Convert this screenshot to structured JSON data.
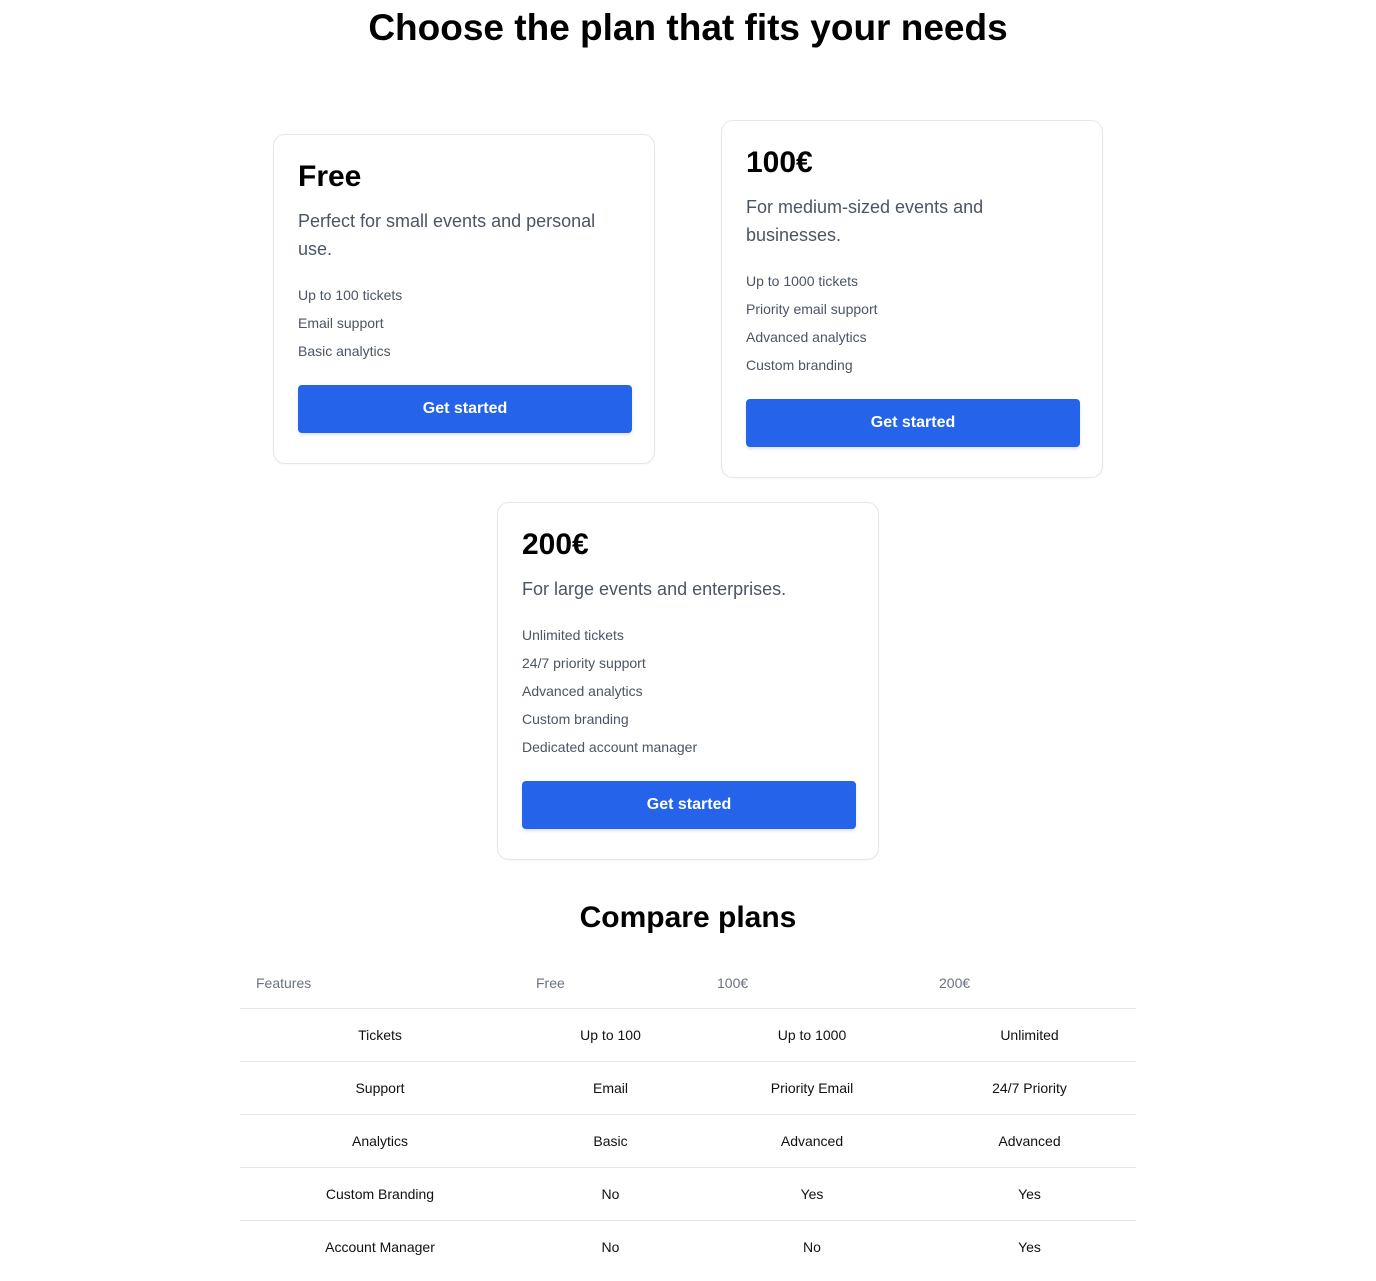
{
  "header": {
    "title": "Choose the plan that fits your needs"
  },
  "plans": [
    {
      "price": "Free",
      "description": "Perfect for small events and personal use.",
      "features": [
        "Up to 100 tickets",
        "Email support",
        "Basic analytics"
      ],
      "cta": "Get started"
    },
    {
      "price": "100€",
      "description": "For medium-sized events and businesses.",
      "features": [
        "Up to 1000 tickets",
        "Priority email support",
        "Advanced analytics",
        "Custom branding"
      ],
      "cta": "Get started"
    },
    {
      "price": "200€",
      "description": "For large events and enterprises.",
      "features": [
        "Unlimited tickets",
        "24/7 priority support",
        "Advanced analytics",
        "Custom branding",
        "Dedicated account manager"
      ],
      "cta": "Get started"
    }
  ],
  "compare": {
    "title": "Compare plans",
    "columns": [
      "Features",
      "Free",
      "100€",
      "200€"
    ],
    "rows": [
      [
        "Tickets",
        "Up to 100",
        "Up to 1000",
        "Unlimited"
      ],
      [
        "Support",
        "Email",
        "Priority Email",
        "24/7 Priority"
      ],
      [
        "Analytics",
        "Basic",
        "Advanced",
        "Advanced"
      ],
      [
        "Custom Branding",
        "No",
        "Yes",
        "Yes"
      ],
      [
        "Account Manager",
        "No",
        "No",
        "Yes"
      ]
    ]
  },
  "colors": {
    "accent": "#2563eb",
    "border": "#e5e7eb",
    "muted_text": "#4b5563"
  }
}
